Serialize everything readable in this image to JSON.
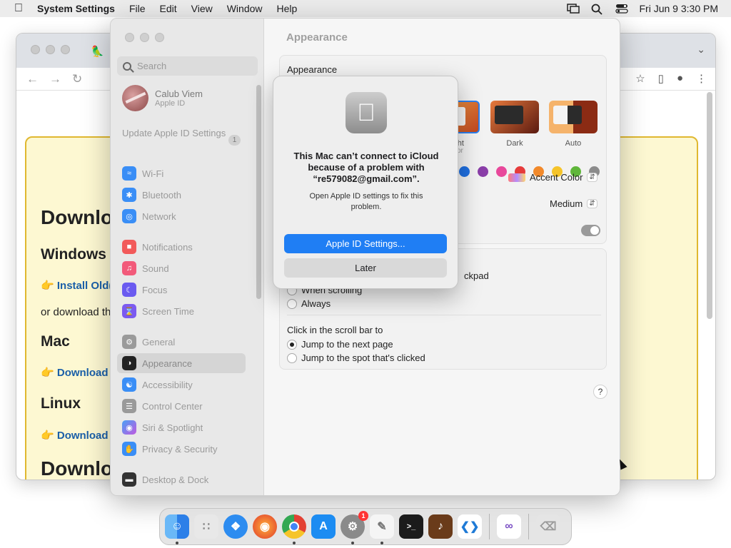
{
  "menubar": {
    "app_name": "System Settings",
    "menus": [
      "File",
      "Edit",
      "View",
      "Window",
      "Help"
    ],
    "clock": "Fri Jun 9  3:30 PM"
  },
  "browser": {
    "page": {
      "h1_top": "Downlo",
      "h2_windows": "Windows",
      "link_install": "Install Old(",
      "text_or": "or download the",
      "h2_mac": "Mac",
      "link_download_mac": "Download",
      "h2_linux": "Linux",
      "link_download_linux": "Download",
      "h1_bottom": "Downlo"
    }
  },
  "settings": {
    "search_placeholder": "Search",
    "profile": {
      "name": "Calub Viem",
      "sub": "Apple ID"
    },
    "update": {
      "label": "Update Apple ID Settings",
      "badge": "1"
    },
    "sidebar_items": [
      {
        "label": "Wi-Fi",
        "color": "#3a8ef6"
      },
      {
        "label": "Bluetooth",
        "color": "#3a8ef6"
      },
      {
        "label": "Network",
        "color": "#3a8ef6"
      },
      {
        "label": "Notifications",
        "color": "#f25a5a"
      },
      {
        "label": "Sound",
        "color": "#f25a7a"
      },
      {
        "label": "Focus",
        "color": "#6a5af0"
      },
      {
        "label": "Screen Time",
        "color": "#7b5af0"
      },
      {
        "label": "General",
        "color": "#9a9a9a"
      },
      {
        "label": "Appearance",
        "color": "#222222"
      },
      {
        "label": "Accessibility",
        "color": "#3a8ef6"
      },
      {
        "label": "Control Center",
        "color": "#9a9a9a"
      },
      {
        "label": "Siri & Spotlight",
        "color": "#c05ae0"
      },
      {
        "label": "Privacy & Security",
        "color": "#3a8ef6"
      },
      {
        "label": "Desktop & Dock",
        "color": "#333333"
      }
    ],
    "title": "Appearance",
    "appearance_label": "Appearance",
    "themes": [
      "Light",
      "Dark",
      "Auto"
    ],
    "selected_theme": "Light",
    "accent_colors": [
      "#1f6fe0",
      "#8a3ea8",
      "#e8489b",
      "#e63b3b",
      "#f2892a",
      "#f6c42a",
      "#5fb63a",
      "#8c8c8c"
    ],
    "accent_label_partial": "or",
    "highlight_popup": "Accent Color",
    "sidebar_size_popup": "Medium",
    "scroll_partial": "ckpad",
    "show_scroll_options": [
      "When scrolling",
      "Always"
    ],
    "click_scroll_label": "Click in the scroll bar to",
    "click_scroll_options": [
      "Jump to the next page",
      "Jump to the spot that's clicked"
    ],
    "click_scroll_selected": 0,
    "help": "?"
  },
  "alert": {
    "title": "This Mac can’t connect to iCloud because of a problem with “re579082@gmail.com”.",
    "message": "Open Apple ID settings to fix this problem.",
    "primary_button": "Apple ID Settings...",
    "secondary_button": "Later"
  },
  "dock": {
    "apps": [
      {
        "name": "finder-icon",
        "color": "#3a9af5"
      },
      {
        "name": "launchpad-icon",
        "color": "#e8e8e8"
      },
      {
        "name": "safari-icon",
        "color": "#2d8cf0"
      },
      {
        "name": "firefox-icon",
        "color": "#ff7a1a"
      },
      {
        "name": "chrome-icon",
        "color": "#e34133"
      },
      {
        "name": "app-store-icon",
        "color": "#1c8cf2"
      },
      {
        "name": "system-settings-icon",
        "color": "#8a8a8a"
      },
      {
        "name": "textedit-icon",
        "color": "#f5f5f5"
      },
      {
        "name": "terminal-icon",
        "color": "#1b1b1b"
      },
      {
        "name": "instruments-icon",
        "color": "#b05a1a"
      },
      {
        "name": "vscode-icon",
        "color": "#ffffff"
      },
      {
        "name": "visual-studio-icon",
        "color": "#ffffff"
      },
      {
        "name": "trash-icon",
        "color": "#e5e5e5"
      }
    ],
    "settings_badge": "1"
  }
}
